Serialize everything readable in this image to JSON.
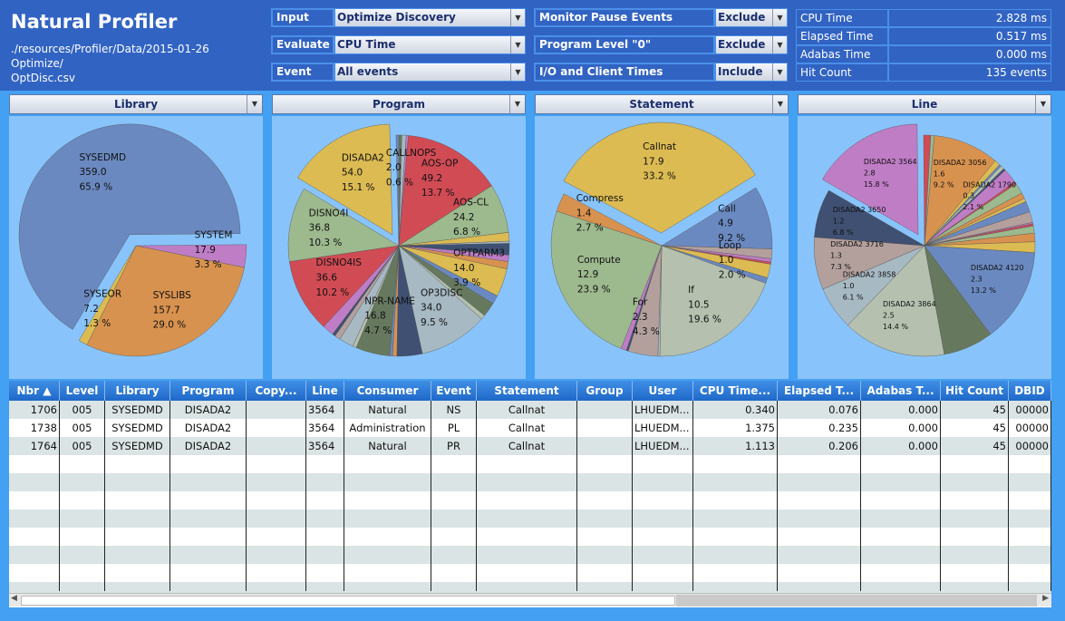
{
  "app": {
    "title": "Natural Profiler",
    "path": "./resources/Profiler/Data/2015-01-26 Optimize/\nOptDisc.csv"
  },
  "controls": {
    "left": [
      {
        "label": "Input",
        "value": "Optimize Discovery"
      },
      {
        "label": "Evaluate",
        "value": "CPU Time"
      },
      {
        "label": "Event",
        "value": "All events"
      }
    ],
    "right": [
      {
        "label": "Monitor Pause Events",
        "value": "Exclude"
      },
      {
        "label": "Program Level \"0\"",
        "value": "Exclude"
      },
      {
        "label": "I/O and Client Times",
        "value": "Include"
      }
    ]
  },
  "stats": [
    {
      "label": "CPU Time",
      "value": "2.828 ms"
    },
    {
      "label": "Elapsed Time",
      "value": "0.517 ms"
    },
    {
      "label": "Adabas Time",
      "value": "0.000 ms"
    },
    {
      "label": "Hit Count",
      "value": "135 events"
    }
  ],
  "colors": {
    "yellow": "#dcbb52",
    "red": "#d04b54",
    "green": "#9db98e",
    "blue": "#6a89c0",
    "navy": "#3f5072",
    "orange": "#d8924f",
    "purple": "#bf7dc6",
    "rose": "#b3a09c",
    "lightblue": "#a7b9c3",
    "darkgreen": "#66795e",
    "lightgray": "#b5c1ae"
  },
  "chart_data": [
    {
      "type": "pie",
      "title": "Library",
      "start_angle": 211,
      "slices": [
        {
          "label": "SYSEDMD",
          "value": "359.0",
          "pct": 65.9,
          "color": "blue",
          "exploded": true
        },
        {
          "label": "SYSTEM",
          "value": "17.9",
          "pct": 3.3,
          "color": "purple"
        },
        {
          "label": "SYSLIBS",
          "value": "157.7",
          "pct": 29.0,
          "color": "orange"
        },
        {
          "label": "SYSEOR",
          "value": "7.2",
          "pct": 1.3,
          "color": "yellow"
        }
      ]
    },
    {
      "type": "pie",
      "title": "Program",
      "start_angle": 301,
      "slices": [
        {
          "label": "DISADA2",
          "value": "54.0",
          "pct": 15.1,
          "color": "yellow",
          "exploded": true
        },
        {
          "pct": 0.4,
          "color": "blue"
        },
        {
          "pct": 0.4,
          "color": "darkgreen"
        },
        {
          "label": "CALLNOPS",
          "value": "2.0",
          "pct": 0.6,
          "color": "lightblue"
        },
        {
          "pct": 0.3,
          "color": "purple"
        },
        {
          "label": "AOS-OP",
          "value": "49.2",
          "pct": 13.7,
          "color": "red"
        },
        {
          "label": "AOS-CL",
          "value": "24.2",
          "pct": 6.8,
          "color": "green"
        },
        {
          "pct": 1.2,
          "color": "yellow"
        },
        {
          "pct": 0.3,
          "color": "lightblue"
        },
        {
          "pct": 1.6,
          "color": "navy"
        },
        {
          "pct": 0.9,
          "color": "purple"
        },
        {
          "pct": 1.0,
          "color": "orange"
        },
        {
          "label": "OPTPARM3",
          "value": "14.0",
          "pct": 3.9,
          "color": "yellow"
        },
        {
          "pct": 1.2,
          "color": "blue"
        },
        {
          "pct": 2.0,
          "color": "darkgreen"
        },
        {
          "pct": 0.6,
          "color": "lightgray"
        },
        {
          "label": "OP3DISC",
          "value": "34.0",
          "pct": 9.5,
          "color": "lightblue"
        },
        {
          "pct": 3.5,
          "color": "navy"
        },
        {
          "pct": 0.6,
          "color": "orange"
        },
        {
          "pct": 0.4,
          "color": "blue"
        },
        {
          "label": "NPR-NAME",
          "value": "16.8",
          "pct": 4.7,
          "color": "darkgreen"
        },
        {
          "pct": 0.5,
          "color": "lightgray"
        },
        {
          "pct": 2.0,
          "color": "lightblue"
        },
        {
          "pct": 0.8,
          "color": "rose"
        },
        {
          "pct": 0.4,
          "color": "navy"
        },
        {
          "pct": 1.6,
          "color": "purple"
        },
        {
          "label": "DISNO4IS",
          "value": "36.6",
          "pct": 10.2,
          "color": "red"
        },
        {
          "label": "DISNO4I",
          "value": "36.8",
          "pct": 10.3,
          "color": "green"
        }
      ]
    },
    {
      "type": "pie",
      "title": "Statement",
      "start_angle": 298,
      "slices": [
        {
          "label": "Callnat",
          "value": "17.9",
          "pct": 33.2,
          "color": "yellow",
          "exploded": true
        },
        {
          "label": "Call",
          "value": "4.9",
          "pct": 9.2,
          "color": "blue"
        },
        {
          "pct": 1.4,
          "color": "rose"
        },
        {
          "pct": 0.5,
          "color": "purple"
        },
        {
          "pct": 0.3,
          "color": "red"
        },
        {
          "label": "Loop",
          "value": "1.0",
          "pct": 2.0,
          "color": "yellow"
        },
        {
          "pct": 0.8,
          "color": "blue"
        },
        {
          "label": "If",
          "value": "10.5",
          "pct": 19.6,
          "color": "lightgray"
        },
        {
          "pct": 0.3,
          "color": "lightblue"
        },
        {
          "label": "For",
          "value": "2.3",
          "pct": 4.3,
          "color": "rose"
        },
        {
          "pct": 0.3,
          "color": "navy"
        },
        {
          "pct": 0.8,
          "color": "purple"
        },
        {
          "label": "Compute",
          "value": "12.9",
          "pct": 23.9,
          "color": "green"
        },
        {
          "label": "Compress",
          "value": "1.4",
          "pct": 2.7,
          "color": "orange"
        }
      ]
    },
    {
      "type": "pie",
      "title": "Line",
      "start_angle": 300,
      "small_labels": true,
      "slices": [
        {
          "label": "DISADA2  3564",
          "value": "2.8",
          "pct": 15.8,
          "color": "purple",
          "exploded": true
        },
        {
          "pct": 1.0,
          "color": "red"
        },
        {
          "pct": 0.5,
          "color": "green"
        },
        {
          "label": "DISADA2  3056",
          "value": "1.6",
          "pct": 9.2,
          "color": "orange"
        },
        {
          "pct": 0.8,
          "color": "yellow"
        },
        {
          "pct": 0.3,
          "color": "blue"
        },
        {
          "pct": 0.5,
          "color": "lightgray"
        },
        {
          "pct": 0.3,
          "color": "navy"
        },
        {
          "label": "DISADA2  1790",
          "value": "0.3",
          "pct": 2.1,
          "color": "purple"
        },
        {
          "pct": 0.3,
          "color": "red"
        },
        {
          "pct": 1.5,
          "color": "green"
        },
        {
          "pct": 0.8,
          "color": "orange"
        },
        {
          "pct": 0.5,
          "color": "yellow"
        },
        {
          "pct": 1.5,
          "color": "blue"
        },
        {
          "pct": 1.5,
          "color": "rose"
        },
        {
          "pct": 0.2,
          "color": "purple"
        },
        {
          "pct": 0.3,
          "color": "red"
        },
        {
          "pct": 1.0,
          "color": "green"
        },
        {
          "pct": 1.2,
          "color": "orange"
        },
        {
          "pct": 1.5,
          "color": "yellow"
        },
        {
          "label": "DISADA2  4120",
          "value": "2.3",
          "pct": 13.2,
          "color": "blue"
        },
        {
          "pct": 7.0,
          "color": "darkgreen"
        },
        {
          "label": "DISADA2  3864",
          "value": "2.5",
          "pct": 14.4,
          "color": "lightgray"
        },
        {
          "label": "DISADA2  3858",
          "value": "1.0",
          "pct": 6.1,
          "color": "lightblue"
        },
        {
          "label": "DISADA2  3716",
          "value": "1.3",
          "pct": 7.3,
          "color": "rose"
        },
        {
          "label": "DISADA2  3650",
          "value": "1.2",
          "pct": 6.8,
          "color": "navy"
        }
      ]
    }
  ],
  "table": {
    "columns": [
      "Nbr ▲",
      "Level",
      "Library",
      "Program",
      "Copy...",
      "Line",
      "Consumer",
      "Event",
      "Statement",
      "Group",
      "User",
      "CPU Time...",
      "Elapsed T...",
      "Adabas T...",
      "Hit Count",
      "DBID"
    ],
    "rows": [
      [
        "1706",
        "005",
        "SYSEDMD",
        "DISADA2",
        "",
        "3564",
        "Natural",
        "NS",
        "Callnat",
        "",
        "LHUEDM...",
        "0.340",
        "0.076",
        "0.000",
        "45",
        "00000"
      ],
      [
        "1738",
        "005",
        "SYSEDMD",
        "DISADA2",
        "",
        "3564",
        "Administration",
        "PL",
        "Callnat",
        "",
        "LHUEDM...",
        "1.375",
        "0.235",
        "0.000",
        "45",
        "00000"
      ],
      [
        "1764",
        "005",
        "SYSEDMD",
        "DISADA2",
        "",
        "3564",
        "Natural",
        "PR",
        "Callnat",
        "",
        "LHUEDM...",
        "1.113",
        "0.206",
        "0.000",
        "45",
        "00000"
      ]
    ]
  }
}
